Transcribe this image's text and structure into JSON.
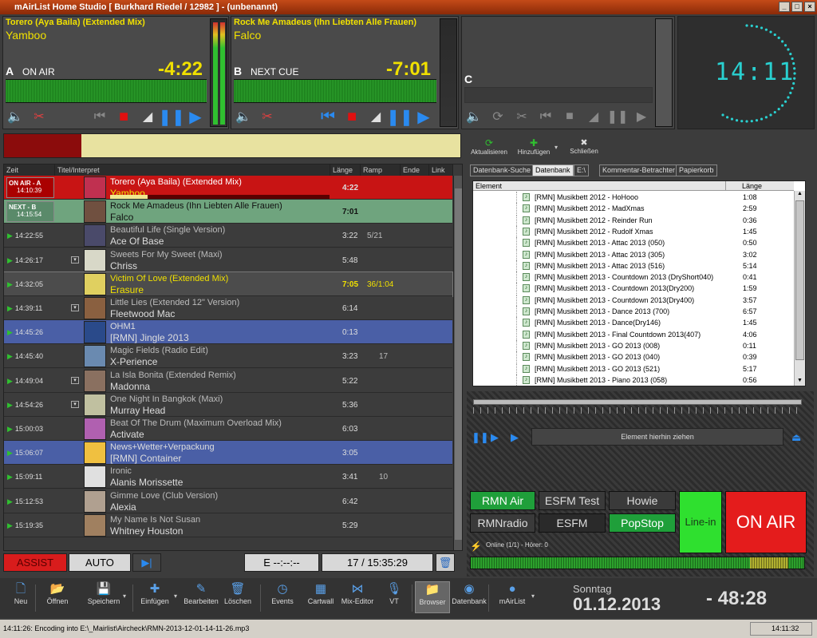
{
  "window": {
    "title": "mAirList Home Studio [ Burkhard  Riedel / 12982 ] - (unbenannt)"
  },
  "players": [
    {
      "letter": "A",
      "state": "ON AIR",
      "title": "Torero (Aya Baila) (Extended Mix)",
      "artist": "Yamboo",
      "time": "-4:22"
    },
    {
      "letter": "B",
      "state": "NEXT CUE",
      "title": "Rock Me Amadeus (Ihn Liebten Alle Frauen)",
      "artist": "Falco",
      "time": "-7:01"
    },
    {
      "letter": "C",
      "state": "",
      "title": "",
      "artist": "",
      "time": ""
    }
  ],
  "clock": {
    "display": "14:11"
  },
  "progress": {
    "played_fraction": 0.17
  },
  "playlist": {
    "headers": {
      "zeit": "Zeit",
      "titel": "Titel/Interpret",
      "laenge": "Länge",
      "ramp": "Ramp",
      "ende": "Ende",
      "link": "Link"
    },
    "rows": [
      {
        "status": "ON AIR - A",
        "time": "14:10:39",
        "title": "Torero (Aya Baila) (Extended Mix)",
        "artist": "Yamboo",
        "length": "4:22",
        "ramp": "",
        "ende": "",
        "bg": "#c81414"
      },
      {
        "status": "NEXT - B",
        "time": "14:15:54",
        "title": "Rock Me Amadeus (Ihn Liebten Alle Frauen)",
        "artist": "Falco",
        "length": "7:01",
        "ramp": "",
        "ende": "",
        "bg": "#6fa47e"
      },
      {
        "status": "",
        "time": "14:22:55",
        "title": "Beautiful Life (Single Version)",
        "artist": "Ace Of Base",
        "length": "3:22",
        "ramp": "5/21",
        "ende": "",
        "bg": "#3c3c3c"
      },
      {
        "status": "",
        "time": "14:26:17",
        "title": "Sweets For My Sweet (Maxi)",
        "artist": "Chriss",
        "length": "5:48",
        "ramp": "",
        "ende": "",
        "bg": "#3c3c3c"
      },
      {
        "status": "",
        "time": "14:32:05",
        "title": "Victim Of Love (Extended Mix)",
        "artist": "Erasure",
        "length": "7:05",
        "ramp": "36/1:04",
        "ende": "",
        "bg": "#4c4c4c"
      },
      {
        "status": "",
        "time": "14:39:11",
        "title": "Little Lies (Extended 12\" Version)",
        "artist": "Fleetwood Mac",
        "length": "6:14",
        "ramp": "",
        "ende": "",
        "bg": "#3c3c3c"
      },
      {
        "status": "",
        "time": "14:45:26",
        "title": "OHM1",
        "artist": "[RMN] Jingle 2013",
        "length": "0:13",
        "ramp": "",
        "ende": "",
        "bg": "#4a5fa6"
      },
      {
        "status": "",
        "time": "14:45:40",
        "title": "Magic Fields (Radio Edit)",
        "artist": "X-Perience",
        "length": "3:23",
        "ramp": "17",
        "ende": "",
        "bg": "#3c3c3c"
      },
      {
        "status": "",
        "time": "14:49:04",
        "title": "La Isla Bonita (Extended Remix)",
        "artist": "Madonna",
        "length": "5:22",
        "ramp": "",
        "ende": "",
        "bg": "#3c3c3c"
      },
      {
        "status": "",
        "time": "14:54:26",
        "title": "One Night In Bangkok (Maxi)",
        "artist": "Murray Head",
        "length": "5:36",
        "ramp": "",
        "ende": "",
        "bg": "#3c3c3c"
      },
      {
        "status": "",
        "time": "15:00:03",
        "title": "Beat Of The Drum (Maximum Overload Mix)",
        "artist": "Activate",
        "length": "6:03",
        "ramp": "",
        "ende": "",
        "bg": "#3c3c3c"
      },
      {
        "status": "",
        "time": "15:06:07",
        "title": "News+Wetter+Verpackung",
        "artist": "[RMN] Container",
        "length": "3:05",
        "ramp": "",
        "ende": "",
        "bg": "#4a5fa6"
      },
      {
        "status": "",
        "time": "15:09:11",
        "title": "Ironic",
        "artist": "Alanis Morissette",
        "length": "3:41",
        "ramp": "10",
        "ende": "",
        "bg": "#3c3c3c"
      },
      {
        "status": "",
        "time": "15:12:53",
        "title": "Gimme Love (Club Version)",
        "artist": "Alexia",
        "length": "6:42",
        "ramp": "",
        "ende": "",
        "bg": "#3c3c3c"
      },
      {
        "status": "",
        "time": "15:19:35",
        "title": "My Name Is Not Susan",
        "artist": "Whitney Houston",
        "length": "5:29",
        "ramp": "",
        "ende": "",
        "bg": "#3c3c3c"
      }
    ]
  },
  "bottom_controls": {
    "assist": "ASSIST",
    "auto": "AUTO",
    "e_time": "E   --:--:--",
    "count": "17 / 15:35:29"
  },
  "browser": {
    "toolbar": {
      "refresh": "Aktualisieren",
      "add": "Hinzufügen",
      "close": "Schließen"
    },
    "tabs": [
      "Datenbank-Suche",
      "Datenbank",
      "E:\\",
      "Kommentar-Betrachter",
      "Papierkorb"
    ],
    "active_tab": "Datenbank",
    "columns": {
      "element": "Element",
      "length": "Länge"
    },
    "items": [
      {
        "name": "[RMN] Musikbett 2012 - HoHooo",
        "length": "1:08"
      },
      {
        "name": "[RMN] Musikbett 2012 - MadXmas",
        "length": "2:59"
      },
      {
        "name": "[RMN] Musikbett 2012 - Reinder Run",
        "length": "0:36"
      },
      {
        "name": "[RMN] Musikbett 2012 - Rudolf Xmas",
        "length": "1:45"
      },
      {
        "name": "[RMN] Musikbett 2013 - Attac 2013 (050)",
        "length": "0:50"
      },
      {
        "name": "[RMN] Musikbett 2013 - Attac 2013 (305)",
        "length": "3:02"
      },
      {
        "name": "[RMN] Musikbett 2013 - Attac 2013 (516)",
        "length": "5:14"
      },
      {
        "name": "[RMN] Musikbett 2013 - Countdown 2013 (DryShort040)",
        "length": "0:41"
      },
      {
        "name": "[RMN] Musikbett 2013 - Countdown 2013(Dry200)",
        "length": "1:59"
      },
      {
        "name": "[RMN] Musikbett 2013 - Countdown 2013(Dry400)",
        "length": "3:57"
      },
      {
        "name": "[RMN] Musikbett 2013 - Dance 2013 (700)",
        "length": "6:57"
      },
      {
        "name": "[RMN] Musikbett 2013 - Dance(Dry146)",
        "length": "1:45"
      },
      {
        "name": "[RMN] Musikbett 2013 - Final Countdown 2013(407)",
        "length": "4:06"
      },
      {
        "name": "[RMN] Musikbett 2013 - GO 2013 (008)",
        "length": "0:11"
      },
      {
        "name": "[RMN] Musikbett 2013 - GO 2013 (040)",
        "length": "0:39"
      },
      {
        "name": "[RMN] Musikbett 2013 - GO 2013 (521)",
        "length": "5:17"
      },
      {
        "name": "[RMN] Musikbett 2013 - Piano 2013 (058)",
        "length": "0:56"
      }
    ]
  },
  "drop_zone": {
    "label": "Element hierhin ziehen"
  },
  "cart_buttons": [
    {
      "label": "RMN Air",
      "bg": "#1f9f3a",
      "color": "#fff"
    },
    {
      "label": "ESFM Test",
      "bg": "#3a3a3a",
      "color": "#ddd"
    },
    {
      "label": "Howie",
      "bg": "#3a3a3a",
      "color": "#ddd"
    },
    {
      "label": "RMNradio",
      "bg": "#3a3a3a",
      "color": "#ddd"
    },
    {
      "label": "ESFM",
      "bg": "#2a2a2a",
      "color": "#ddd"
    },
    {
      "label": "PopStop",
      "bg": "#1f9f3a",
      "color": "#fff"
    }
  ],
  "line_in": {
    "label": "Line-in",
    "bg": "#2fe02f"
  },
  "on_air": {
    "label": "ON AIR",
    "bg": "#e41c1c"
  },
  "online_status": "Online (1/1) - Hörer: 0",
  "toolbar": [
    {
      "label": "Neu",
      "icon": "new-file-icon",
      "glyph": "🗋"
    },
    {
      "label": "Öffnen",
      "icon": "open-folder-icon",
      "glyph": "📂"
    },
    {
      "label": "Speichern",
      "icon": "save-icon",
      "glyph": "💾"
    },
    {
      "label": "Einfügen",
      "icon": "insert-plus-icon",
      "glyph": "✚"
    },
    {
      "label": "Bearbeiten",
      "icon": "edit-icon",
      "glyph": "✎"
    },
    {
      "label": "Löschen",
      "icon": "trash-icon",
      "glyph": "🗑"
    },
    {
      "label": "Events",
      "icon": "clock-icon",
      "glyph": "◷"
    },
    {
      "label": "Cartwall",
      "icon": "cartwall-icon",
      "glyph": "▦"
    },
    {
      "label": "Mix-Editor",
      "icon": "mix-editor-icon",
      "glyph": "⋈"
    },
    {
      "label": "VT",
      "icon": "microphone-icon",
      "glyph": "🎙"
    },
    {
      "label": "Browser",
      "icon": "browser-folder-icon",
      "glyph": "📁"
    },
    {
      "label": "Datenbank",
      "icon": "database-icon",
      "glyph": "◉"
    },
    {
      "label": "mAirList",
      "icon": "mairlist-logo-icon",
      "glyph": "●"
    }
  ],
  "date_display": {
    "weekday": "Sonntag",
    "date": "01.12.2013",
    "countdown": "- 48:28"
  },
  "status_bar": {
    "message": "14:11:26: Encoding into E:\\_Mairlist\\Aircheck\\RMN-2013-12-01-14-11-26.mp3",
    "time": "14:11:32"
  }
}
